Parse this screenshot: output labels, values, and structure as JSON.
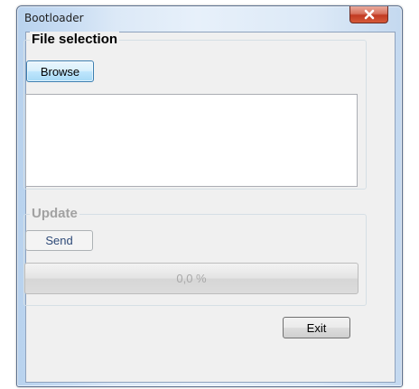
{
  "window": {
    "title": "Bootloader"
  },
  "file_selection": {
    "legend": "File selection",
    "browse_label": "Browse"
  },
  "update": {
    "legend": "Update",
    "send_label": "Send",
    "progress_text": "0,0 %",
    "progress_value": 0
  },
  "footer": {
    "exit_label": "Exit"
  },
  "colors": {
    "close_button": "#c23a22",
    "group_disabled_text": "#a2a2a2",
    "progress_fill": "#06b025"
  }
}
